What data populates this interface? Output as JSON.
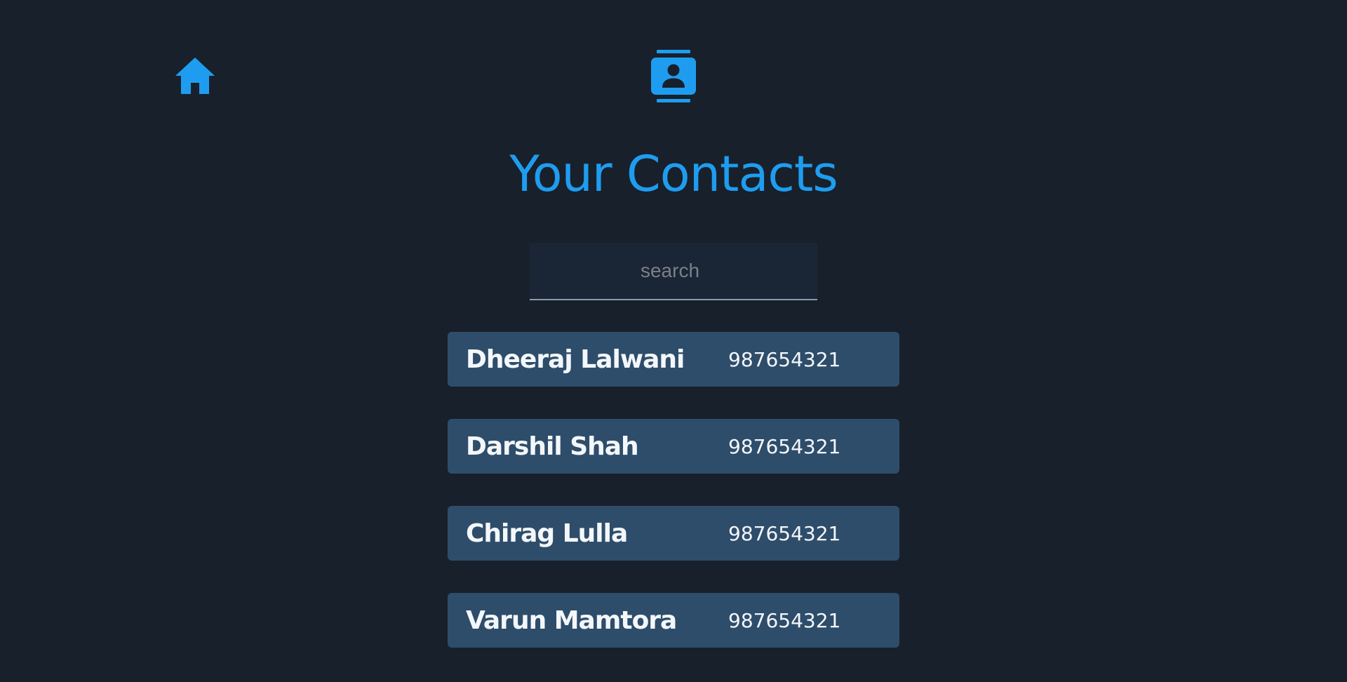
{
  "colors": {
    "background": "#18202b",
    "accent": "#1e9df0",
    "card": "#2e4d6b",
    "text": "#f4f7fa"
  },
  "nav": {
    "home_icon": "home-icon",
    "contacts_icon": "contact-book-icon"
  },
  "header": {
    "title": "Your Contacts"
  },
  "search": {
    "placeholder": "search",
    "value": ""
  },
  "contacts": [
    {
      "name": "Dheeraj Lalwani",
      "phone": "987654321"
    },
    {
      "name": "Darshil Shah",
      "phone": "987654321"
    },
    {
      "name": "Chirag Lulla",
      "phone": "987654321"
    },
    {
      "name": "Varun Mamtora",
      "phone": "987654321"
    }
  ]
}
